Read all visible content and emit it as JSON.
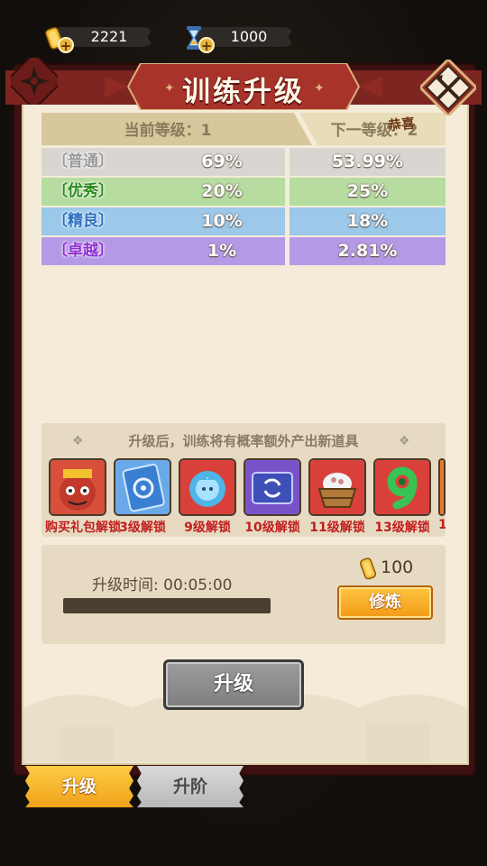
{
  "currency": {
    "coin_amount": "2221",
    "hourglass_amount": "1000",
    "plus_symbol": "+"
  },
  "title": "训练升级",
  "level_header": {
    "current": "当前等级：1",
    "next": "下一等级：2",
    "congrats": "恭喜"
  },
  "probabilities": [
    {
      "label": "〔普通〕",
      "current": "69%",
      "next": "53.99%",
      "row_color": "#d9d6d2",
      "label_color": "#9a9a9a"
    },
    {
      "label": "〔优秀〕",
      "current": "20%",
      "next": "25%",
      "row_color": "#b6dca0",
      "label_color": "#2d8a1e"
    },
    {
      "label": "〔精良〕",
      "current": "10%",
      "next": "18%",
      "row_color": "#9cc8ea",
      "label_color": "#2a6fbf"
    },
    {
      "label": "〔卓越〕",
      "current": "1%",
      "next": "2.81%",
      "row_color": "#b49ae6",
      "label_color": "#8e2fd0"
    }
  ],
  "unlock": {
    "title": "升级后，训练将有概率额外产出新道具",
    "diamond": "❖",
    "items": [
      {
        "icon": "monkey-king-gift-icon",
        "label": "购买礼包解锁",
        "bg": "#d8503a"
      },
      {
        "icon": "blue-card-icon",
        "label": "3级解锁",
        "bg": "#6aa9e8"
      },
      {
        "icon": "blue-spirit-icon",
        "label": "9级解锁",
        "bg": "#d9403a"
      },
      {
        "icon": "purple-card-icon",
        "label": "10级解锁",
        "bg": "#7a52c8"
      },
      {
        "icon": "rice-basket-icon",
        "label": "11级解锁",
        "bg": "#d9403a"
      },
      {
        "icon": "green-nine-icon",
        "label": "13级解锁",
        "bg": "#d9403a"
      },
      {
        "icon": "partial-item-icon",
        "label": "1",
        "bg": "#e87a2a"
      }
    ]
  },
  "upgrade_time": {
    "label": "升级时间: 00:05:00",
    "progress": 0.0
  },
  "cost": {
    "amount": "100"
  },
  "train_button_label": "修炼",
  "upgrade_button_label": "升级",
  "tabs": {
    "upgrade": "升级",
    "advance": "升阶"
  },
  "colors": {
    "panel_red": "#8e2a22",
    "parchment": "#f4ecd8",
    "gold": "#f2b531"
  }
}
